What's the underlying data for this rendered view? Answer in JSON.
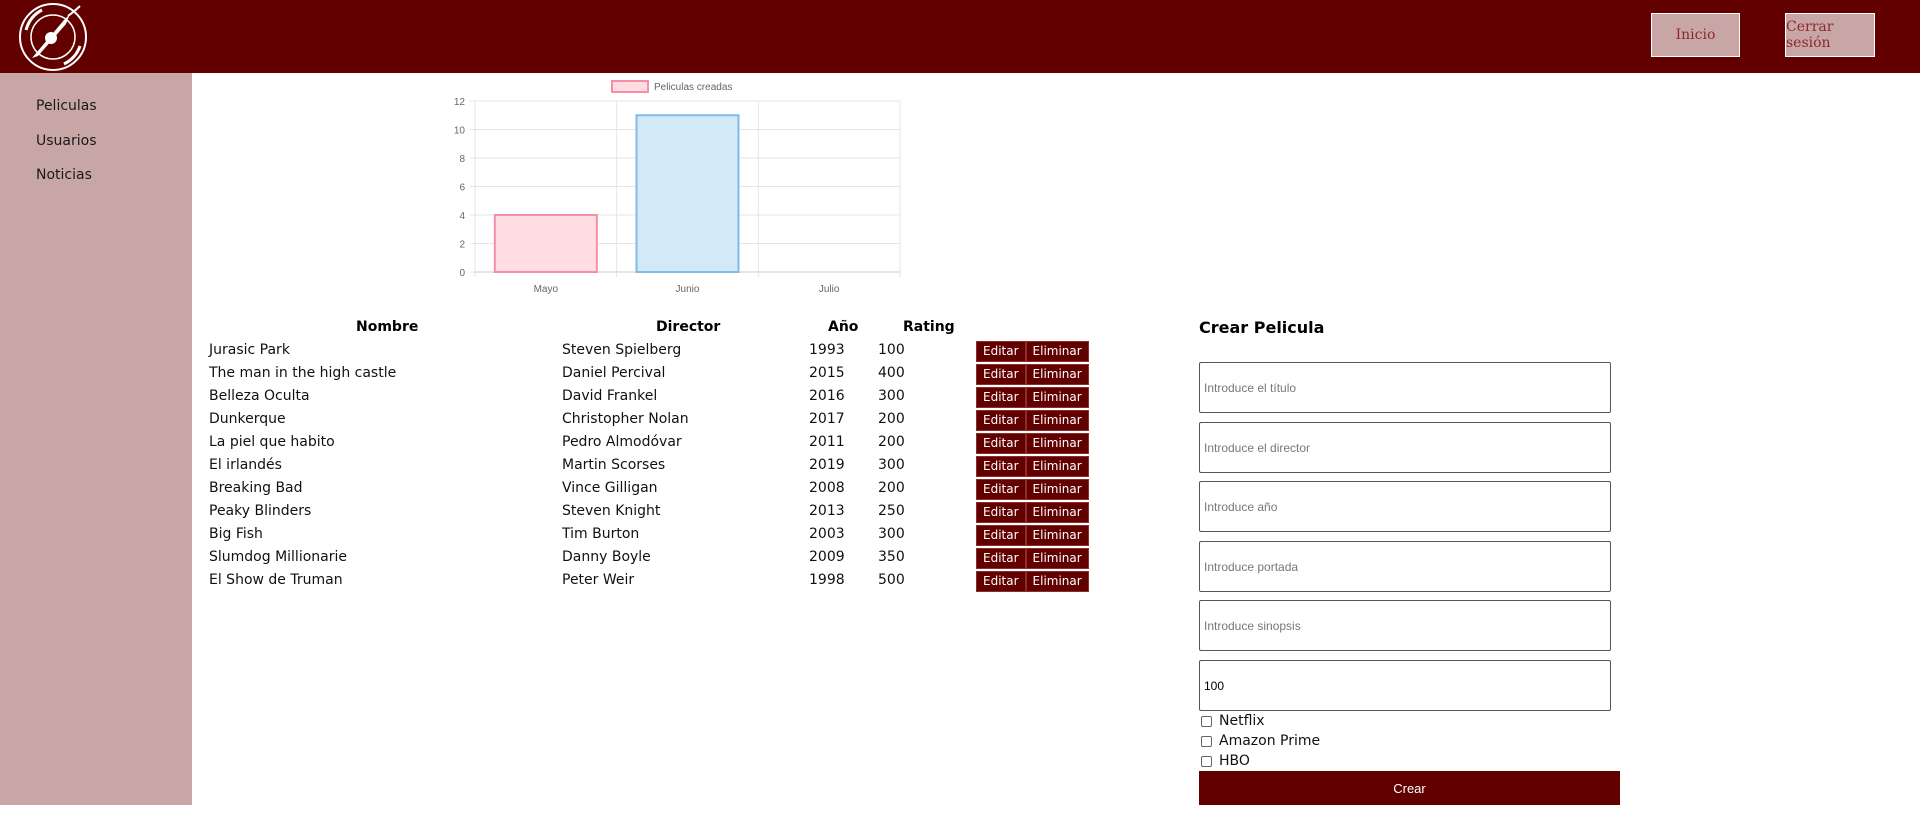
{
  "header": {
    "logo_alt": "Where I Watch logo",
    "inicio_label": "Inicio",
    "logout_label": "Cerrar sesión",
    "brand_color": "#620000"
  },
  "sidebar": {
    "items": [
      {
        "label": "Peliculas"
      },
      {
        "label": "Usuarios"
      },
      {
        "label": "Noticias"
      }
    ]
  },
  "chart_data": {
    "type": "bar",
    "categories": [
      "Mayo",
      "Junio",
      "Julio"
    ],
    "series": [
      {
        "name": "Peliculas creadas",
        "values": [
          4,
          11,
          0
        ]
      }
    ],
    "ylim": [
      0,
      12
    ],
    "yticks": [
      0,
      2,
      4,
      6,
      8,
      10,
      12
    ],
    "grid": true,
    "legend": "top",
    "bar_colors": [
      "#ffdde3",
      "#d4e9f8",
      "#fff4d8"
    ],
    "bar_borders": [
      "#f68ea5",
      "#7fbbe8",
      "#ffce6a"
    ]
  },
  "table": {
    "headers": [
      "Nombre",
      "Director",
      "Año",
      "Rating"
    ],
    "edit_label": "Editar",
    "delete_label": "Eliminar",
    "rows": [
      [
        "Jurasic Park",
        "Steven Spielberg",
        "1993",
        "100"
      ],
      [
        "The man in the high castle",
        "Daniel Percival",
        "2015",
        "400"
      ],
      [
        "Belleza Oculta",
        "David Frankel",
        "2016",
        "300"
      ],
      [
        "Dunkerque",
        "Christopher Nolan",
        "2017",
        "200"
      ],
      [
        "La piel que habito",
        "Pedro Almodóvar",
        "2011",
        "200"
      ],
      [
        "El irlandés",
        "Martin Scorses",
        "2019",
        "300"
      ],
      [
        "Breaking Bad",
        "Vince Gilligan",
        "2008",
        "200"
      ],
      [
        "Peaky Blinders",
        "Steven Knight",
        "2013",
        "250"
      ],
      [
        "Big Fish",
        "Tim Burton",
        "2003",
        "300"
      ],
      [
        "Slumdog Millionarie",
        "Danny Boyle",
        "2009",
        "350"
      ],
      [
        "El Show de Truman",
        "Peter Weir",
        "1998",
        "500"
      ]
    ]
  },
  "form": {
    "title": "Crear Pelicula",
    "title_placeholder": "Introduce el título",
    "director_placeholder": "Introduce el director",
    "year_placeholder": "Introduce año",
    "cover_placeholder": "Introduce portada",
    "synopsis_placeholder": "Introduce sinopsis",
    "rating_value": "100",
    "platforms": [
      {
        "label": "Netflix",
        "checked": false
      },
      {
        "label": "Amazon Prime",
        "checked": false
      },
      {
        "label": "HBO",
        "checked": false
      }
    ],
    "submit_label": "Crear"
  }
}
